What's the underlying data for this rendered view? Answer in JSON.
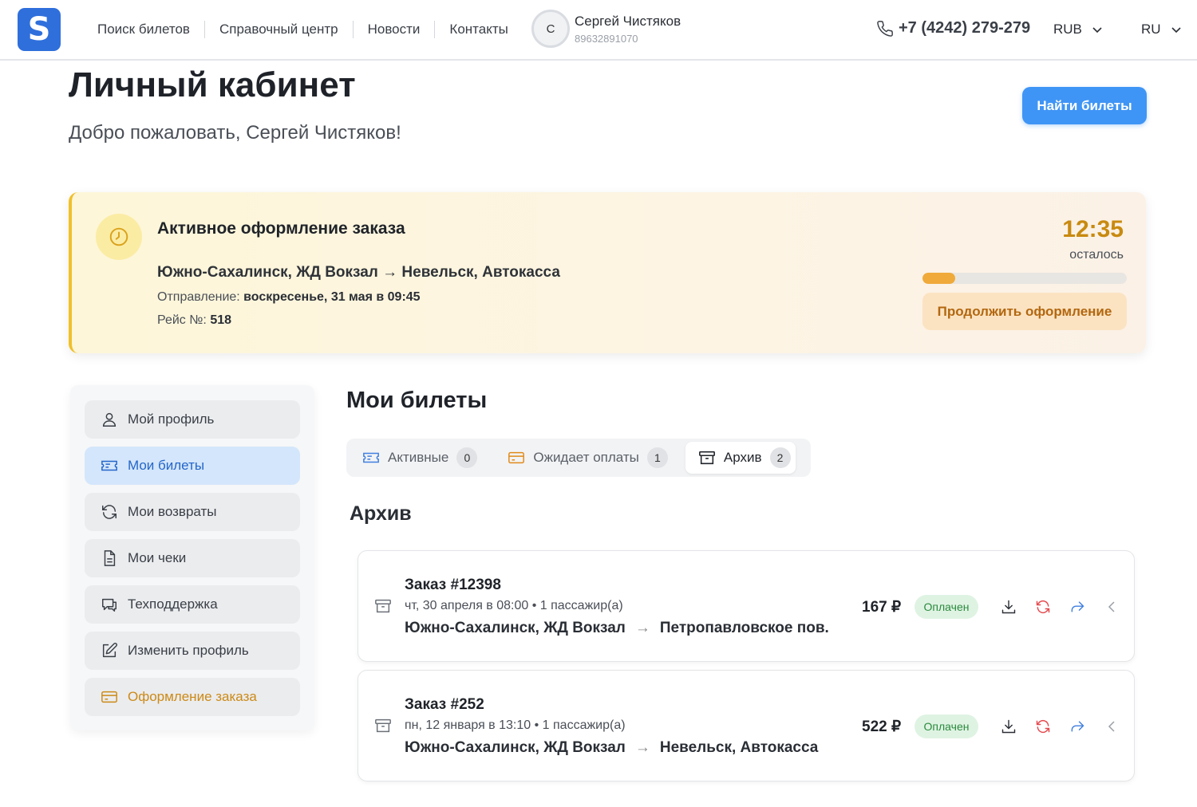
{
  "header": {
    "logo_letter": "S",
    "nav": [
      "Поиск билетов",
      "Справочный центр",
      "Новости",
      "Контакты"
    ],
    "user": {
      "initial": "С",
      "name": "Сергей Чистяков",
      "phone": "89632891070"
    },
    "support_phone": "+7 (4242) 279-279",
    "currency": "RUB",
    "language": "RU"
  },
  "page": {
    "title": "Личный кабинет",
    "welcome": "Добро пожаловать, Сергей Чистяков!",
    "find_button": "Найти билеты"
  },
  "active_order": {
    "title": "Активное оформление заказа",
    "route": "Южно-Сахалинск, ЖД Вокзал → Невельск, Автокасса",
    "departure_label": "Отправление:",
    "departure_value": "воскресенье, 31 мая в 09:45",
    "trip_label": "Рейс №:",
    "trip_value": "518",
    "timer": "12:35",
    "timer_label": "осталось",
    "progress": 0.16,
    "continue_button": "Продолжить оформление"
  },
  "sidebar": {
    "items": [
      {
        "label": "Мой профиль",
        "icon": "user-icon"
      },
      {
        "label": "Мои билеты",
        "icon": "ticket-icon"
      },
      {
        "label": "Мои возвраты",
        "icon": "refresh-icon"
      },
      {
        "label": "Мои чеки",
        "icon": "document-icon"
      },
      {
        "label": "Техподдержка",
        "icon": "chat-icon"
      },
      {
        "label": "Изменить профиль",
        "icon": "edit-icon"
      },
      {
        "label": "Оформление заказа",
        "icon": "card-icon"
      }
    ]
  },
  "tickets": {
    "title": "Мои билеты",
    "tabs": [
      {
        "label": "Активные",
        "count": "0"
      },
      {
        "label": "Ожидает оплаты",
        "count": "1"
      },
      {
        "label": "Архив",
        "count": "2"
      }
    ],
    "section_title": "Архив",
    "orders": [
      {
        "number": "Заказ #12398",
        "meta": "чт, 30 апреля в 08:00 • 1 пассажир(а)",
        "from": "Южно-Сахалинск, ЖД Вокзал",
        "arrow": "→",
        "to": "Петропавловское пов.",
        "price": "167 ₽",
        "status": "Оплачен"
      },
      {
        "number": "Заказ #252",
        "meta": "пн, 12 января в 13:10 • 1 пассажир(а)",
        "from": "Южно-Сахалинск, ЖД Вокзал",
        "arrow": "→",
        "to": "Невельск, Автокасса",
        "price": "522 ₽",
        "status": "Оплачен"
      }
    ]
  },
  "colors": {
    "brand": "#2f6fdc",
    "primary_button": "#3f95f5",
    "timer": "#c88a10",
    "status_paid": "#2b8a3e"
  }
}
